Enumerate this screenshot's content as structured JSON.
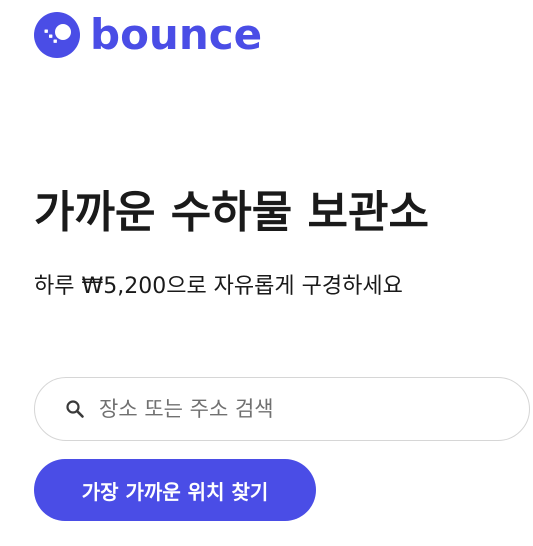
{
  "brand": {
    "name": "bounce",
    "color": "#4a4de6",
    "logo_icon": "bounce-logo-icon"
  },
  "hero": {
    "title": "가까운 수하물 보관소",
    "subtitle": "하루 ₩5,200으로 자유롭게 구경하세요"
  },
  "search": {
    "icon": "search-icon",
    "placeholder": "장소 또는 주소 검색",
    "value": ""
  },
  "cta": {
    "label": "가장 가까운 위치 찾기"
  }
}
